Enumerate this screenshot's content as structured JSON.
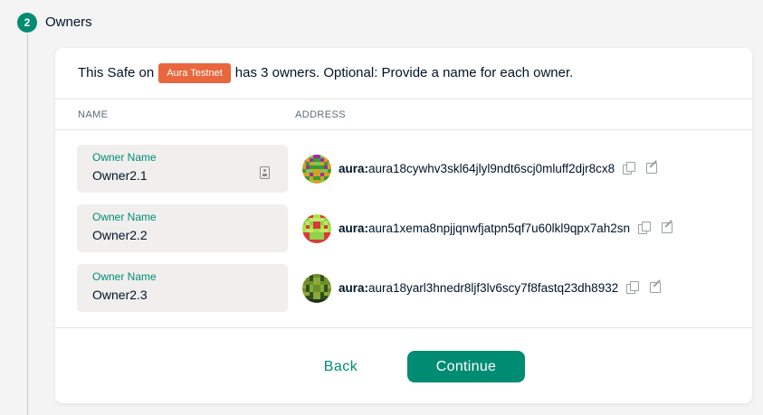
{
  "step": {
    "number": "2",
    "title": "Owners"
  },
  "card": {
    "intro_before": "This Safe on",
    "network": "Aura Testnet",
    "intro_after": "has 3 owners. Optional: Provide a name for each owner.",
    "columns": {
      "name": "NAME",
      "address": "ADDRESS"
    }
  },
  "owners": [
    {
      "field_label": "Owner Name",
      "name": "Owner2.1",
      "prefix": "aura:",
      "address": "aura18cywhv3skl64jlyl9ndt6scj0mluff2djr8cx8",
      "identicon_colors": [
        "#9b2fa0",
        "#d6a123",
        "#3a9a3a",
        "#7ec84b"
      ]
    },
    {
      "field_label": "Owner Name",
      "name": "Owner2.2",
      "prefix": "aura:",
      "address": "aura1xema8npjjqnwfjatpn5qf7u60lkl9qpx7ah2sn",
      "identicon_colors": [
        "#a6e34a",
        "#d83a3a",
        "#8fd24a",
        "#c5e86a"
      ]
    },
    {
      "field_label": "Owner Name",
      "name": "Owner2.3",
      "prefix": "aura:",
      "address": "aura18yarl3hnedr8ljf3lv6scy7f8fastq23dh8932",
      "identicon_colors": [
        "#2f4f1e",
        "#6b8f2a",
        "#1e3318",
        "#8aa83a"
      ]
    }
  ],
  "footer": {
    "back_label": "Back",
    "continue_label": "Continue"
  },
  "colors": {
    "accent": "#008c73",
    "network_pill": "#e8673c",
    "field_bg": "#f0efee"
  },
  "icons": {
    "contact": "address-book-icon",
    "copy": "copy-icon",
    "external": "external-link-icon"
  }
}
